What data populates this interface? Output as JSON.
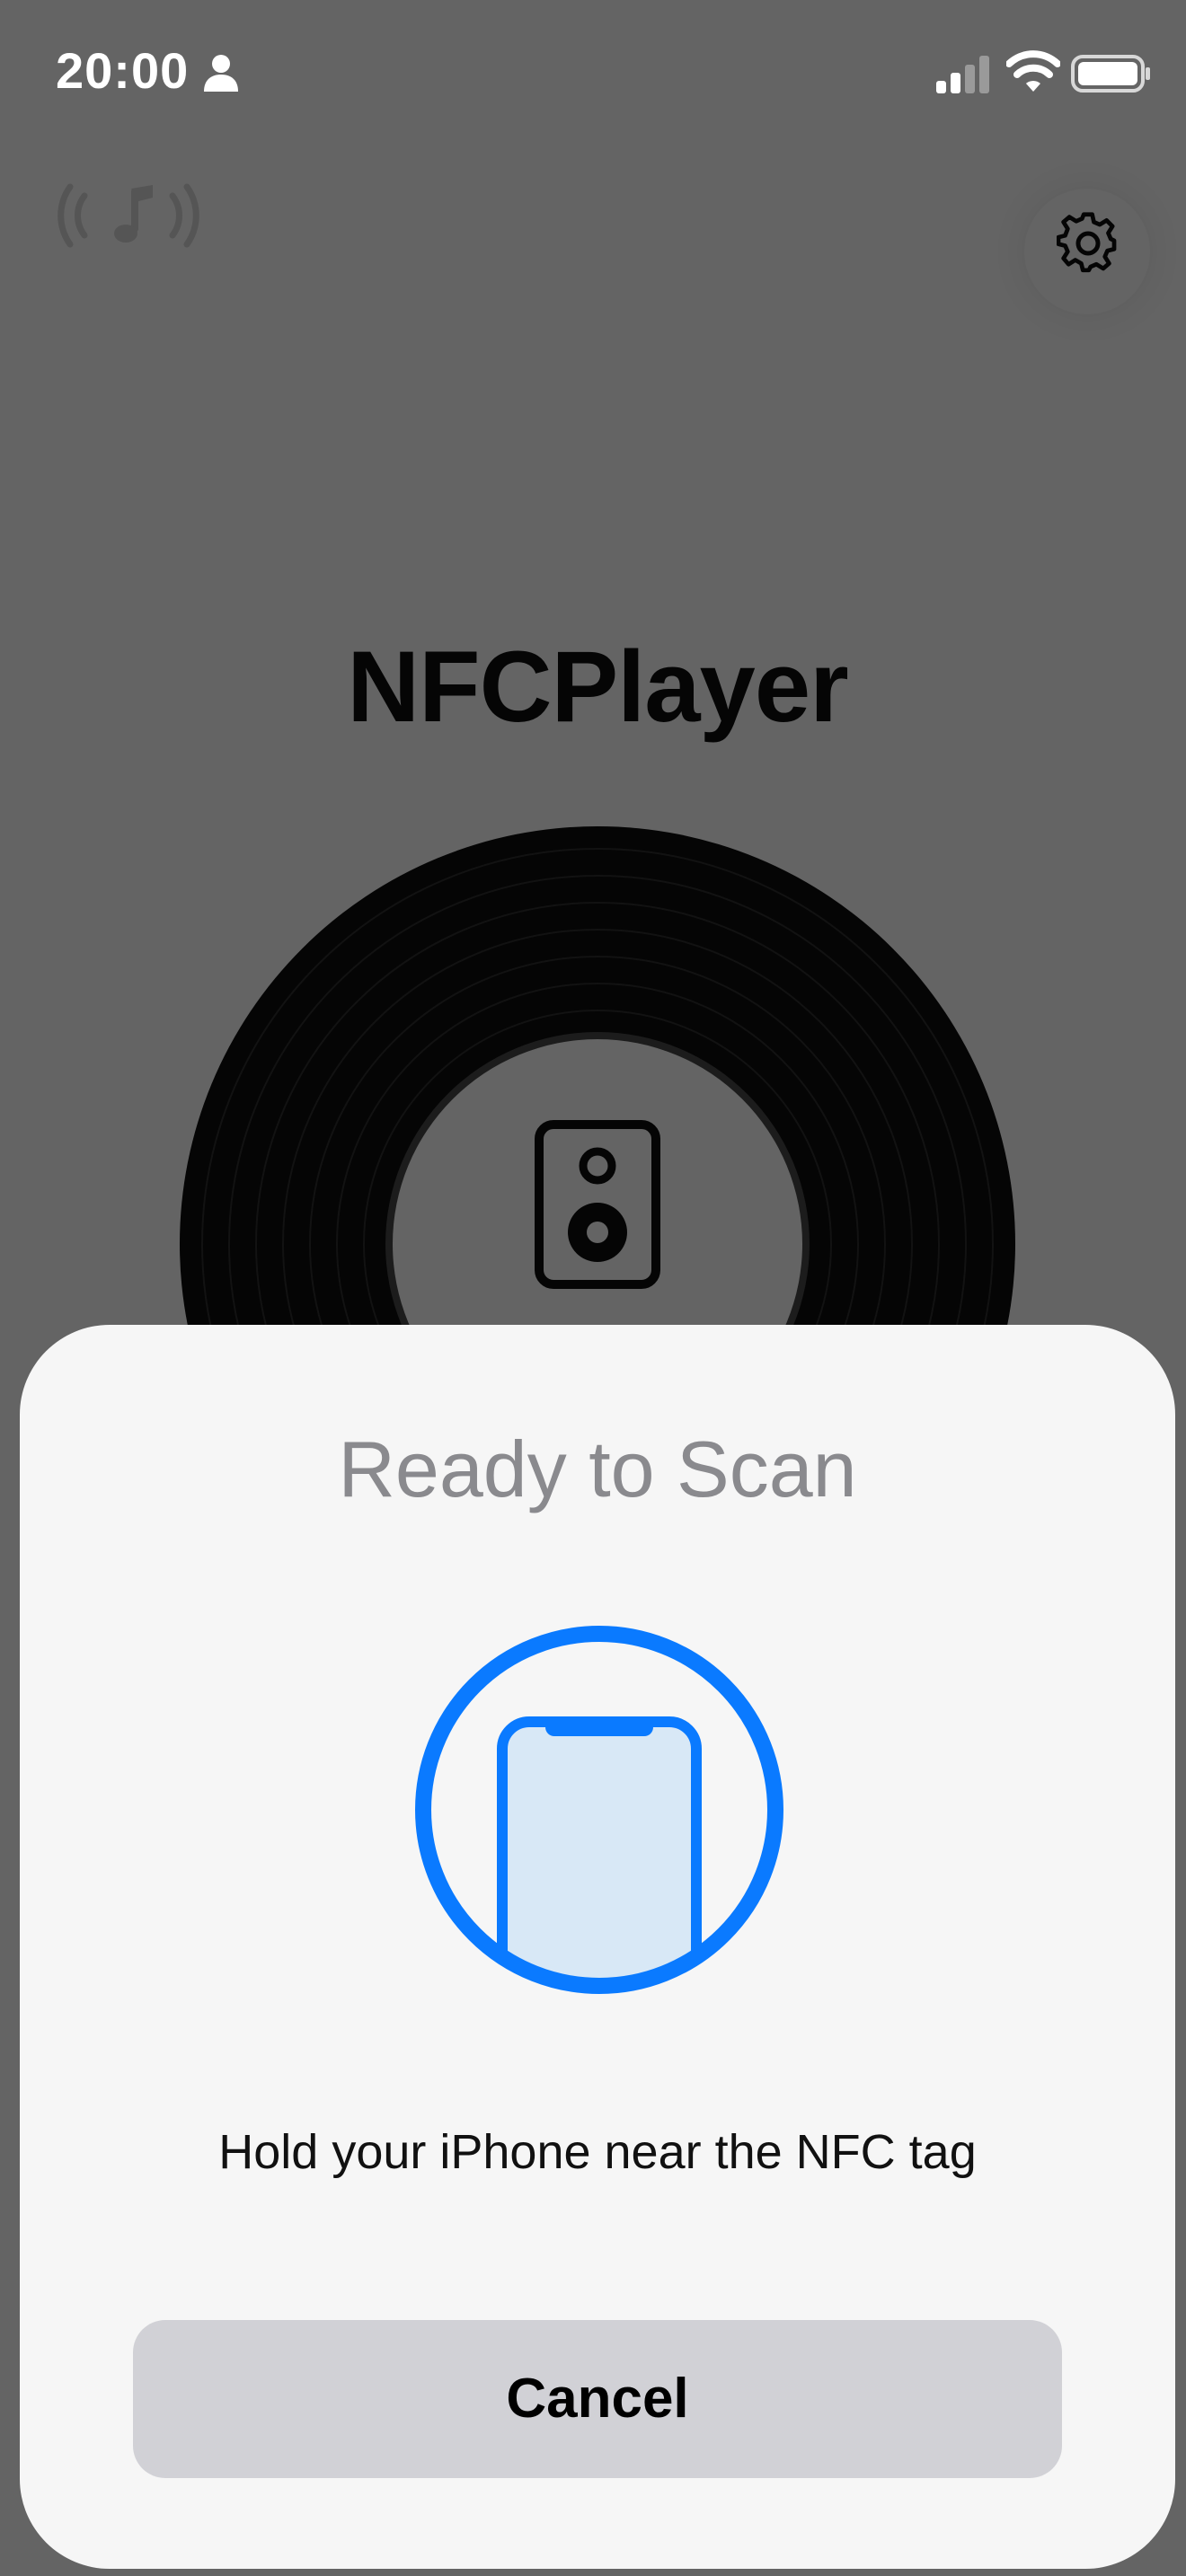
{
  "status_bar": {
    "time": "20:00",
    "person_icon": "person-icon",
    "signal_icon": "cellular-signal-icon",
    "wifi_icon": "wifi-icon",
    "battery_icon": "battery-icon"
  },
  "toolbar": {
    "nfc_icon": "nfc-music-icon",
    "settings_icon": "gear-icon"
  },
  "app": {
    "title": "NFCPlayer",
    "record_icon": "vinyl-record",
    "speaker_icon": "speaker-icon"
  },
  "scan_sheet": {
    "title": "Ready to Scan",
    "graphic_icon": "iphone-scan-icon",
    "message": "Hold your iPhone near the NFC tag",
    "cancel_label": "Cancel"
  },
  "colors": {
    "dim_background": "#646464",
    "sheet_background": "#f6f6f6",
    "accent_blue": "#0a7aff",
    "phone_fill": "#d8e8f6",
    "button_gray": "#d1d1d6",
    "title_gray": "#8a8a8e"
  }
}
